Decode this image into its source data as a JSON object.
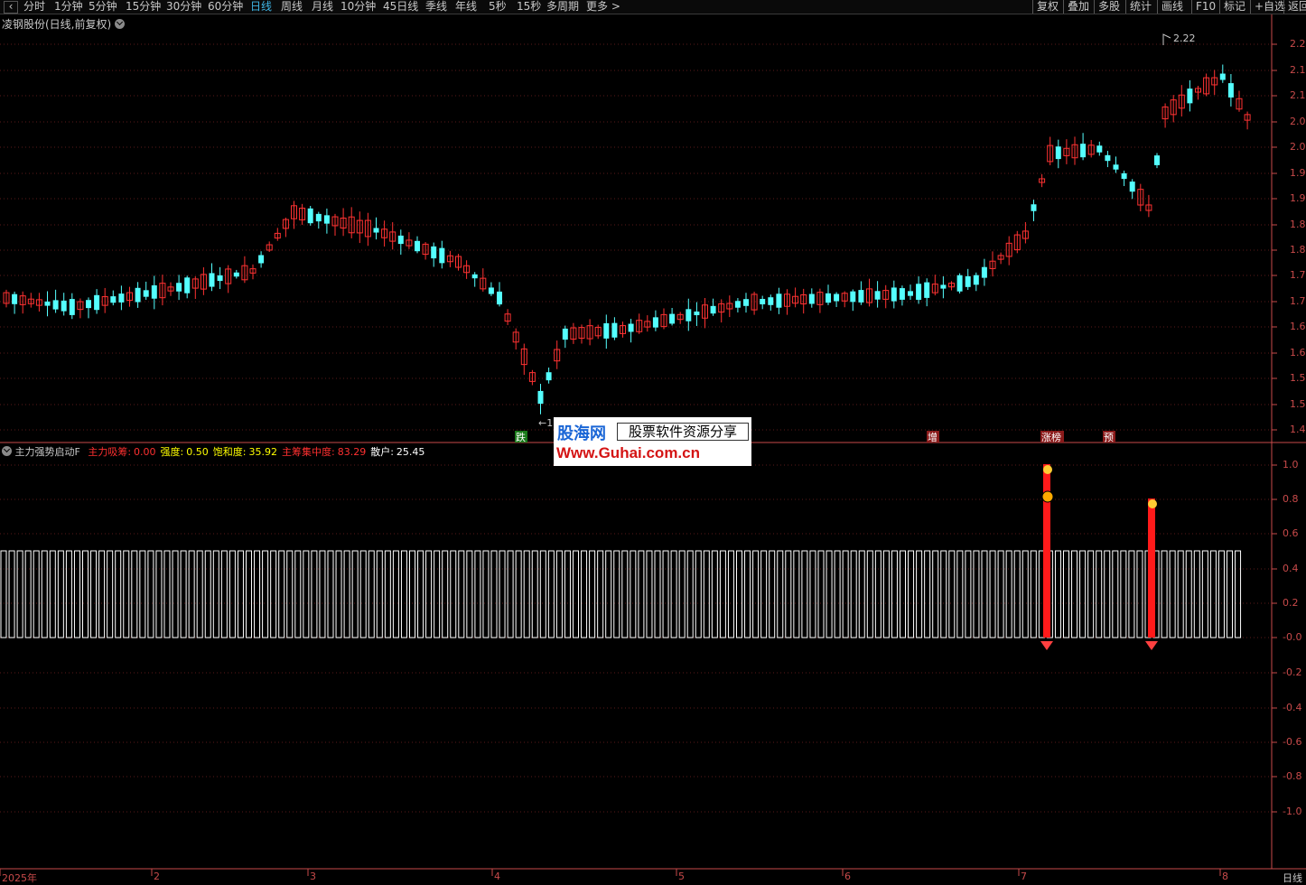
{
  "toolbar": {
    "periods": [
      "分时",
      "1分钟",
      "5分钟",
      "15分钟",
      "30分钟",
      "60分钟",
      "日线",
      "周线",
      "月线",
      "10分钟",
      "45日线",
      "季线",
      "年线",
      "5秒",
      "15秒",
      "多周期",
      "更多 >"
    ],
    "active": "日线",
    "right_buttons": [
      "复权",
      "叠加",
      "多股",
      "统计",
      "画线",
      "F10",
      "标记",
      "+自选",
      "返回"
    ]
  },
  "stock": {
    "title": "凌钢股份(日线,前复权)"
  },
  "price_axis": {
    "labels": [
      "2.2",
      "2.1",
      "2.1",
      "2.0",
      "2.0",
      "1.9",
      "1.9",
      "1.8",
      "1.8",
      "1.7",
      "1.7",
      "1.6",
      "1.6",
      "1.5",
      "1.5",
      "1.4"
    ]
  },
  "markers": {
    "high_label": "2.22",
    "low_label": "1",
    "signals": [
      "跌",
      "增",
      "涨榜",
      "预"
    ]
  },
  "indicator": {
    "name": "主力强势启动F",
    "fields": [
      {
        "label": "主力吸筹:",
        "value": "0.00",
        "color": "#ff3030"
      },
      {
        "label": "强度:",
        "value": "0.50",
        "color": "#ffff00"
      },
      {
        "label": "饱和度:",
        "value": "35.92",
        "color": "#ffff00"
      },
      {
        "label": "主筹集中度:",
        "value": "83.29",
        "color": "#ff3030"
      },
      {
        "label": "散户:",
        "value": "25.45",
        "color": "#ffffff"
      }
    ],
    "axis_labels": [
      "1.0",
      "0.8",
      "0.6",
      "0.4",
      "0.2",
      "-0.0",
      "-0.2",
      "-0.4",
      "-0.6",
      "-0.8",
      "-1.0"
    ]
  },
  "date_axis": {
    "labels": [
      "2025年",
      "2",
      "3",
      "4",
      "5",
      "6",
      "7",
      "8"
    ],
    "right_label": "日线"
  },
  "watermark": {
    "brand": "股海网",
    "tagline": "股票软件资源分享",
    "url": "Www.Guhai.com.cn"
  },
  "colors": {
    "up": "#ff3232",
    "down": "#54ffff",
    "axis": "#c84a4a",
    "active": "#3fb6e6"
  },
  "chart_data": {
    "type": "candlestick",
    "indicator_spikes": [
      {
        "index": 137,
        "value": 1.0
      },
      {
        "index": 150,
        "value": 0.8
      }
    ]
  }
}
